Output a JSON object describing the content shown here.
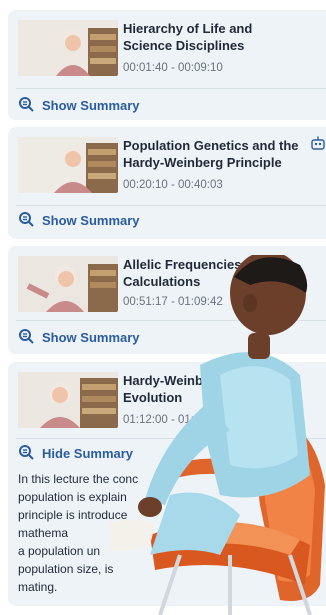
{
  "lectures": [
    {
      "title": "Hierarchy of Life and Science Disciplines",
      "time": "00:01:40 - 00:09:10",
      "summary_label": "Show Summary"
    },
    {
      "title": "Population Genetics and the Hardy-Weinberg Principle",
      "time": "00:20:10 - 00:40:03",
      "summary_label": "Show Summary"
    },
    {
      "title": "Allelic Frequencies and Calculations",
      "time": "00:51:17 - 01:09:42",
      "summary_label": "Show Summary"
    },
    {
      "title": "Hardy-Weinberg Equi... Evolution",
      "time": "01:12:00 - 01:16:21",
      "summary_label": "Hide Summary"
    }
  ],
  "summary_lines": [
    "In this lecture the conc",
    "population is explain",
    "principle is introduce           principle pr",
    "mathema",
    "a population un",
    "population size, is",
    "mating."
  ],
  "icons": {
    "summary": "search-doc-icon",
    "bot": "robot-icon"
  },
  "colors": {
    "accent": "#2b5c9e",
    "card_bg": "#eef3f8",
    "chair": "#e0652b",
    "shirt": "#9fd3e6"
  }
}
